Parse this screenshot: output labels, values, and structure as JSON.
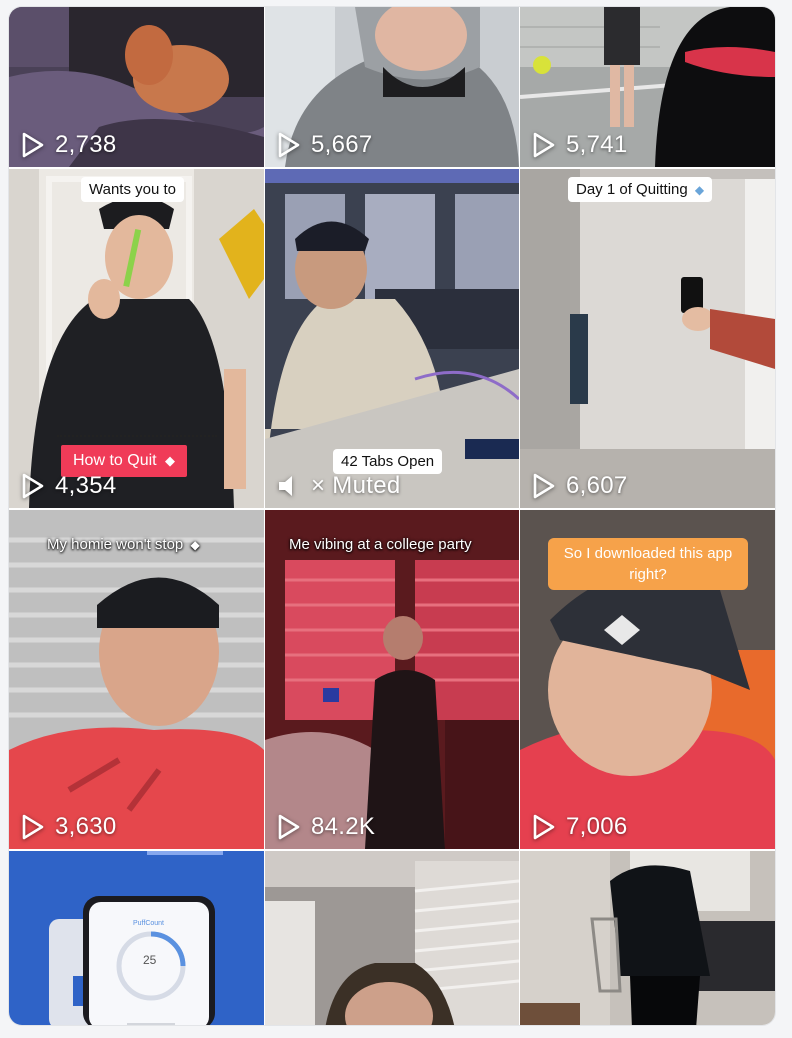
{
  "colors": {
    "card_border": "#e3e5e8",
    "caption_orange": "#f6a24a",
    "caption_red": "#f03b58",
    "view_text": "#ffffff"
  },
  "tiles": [
    {
      "views": "2,738"
    },
    {
      "views": "5,667"
    },
    {
      "views": "5,741"
    },
    {
      "views": "4,354",
      "caption": "Wants you to",
      "overlay": "How to Quit"
    },
    {
      "views": "Muted",
      "caption": "42 Tabs Open",
      "icon": "speaker-muted-icon"
    },
    {
      "views": "6,607",
      "caption": "Day 1 of Quitting"
    },
    {
      "views": "3,630",
      "caption": "My homie won't stop"
    },
    {
      "views": "84.2K",
      "caption": "Me vibing at a college party"
    },
    {
      "views": "7,006",
      "caption": "So I downloaded this app right?"
    },
    {
      "app_name": "PuffCount",
      "counter": "25"
    },
    {},
    {}
  ]
}
